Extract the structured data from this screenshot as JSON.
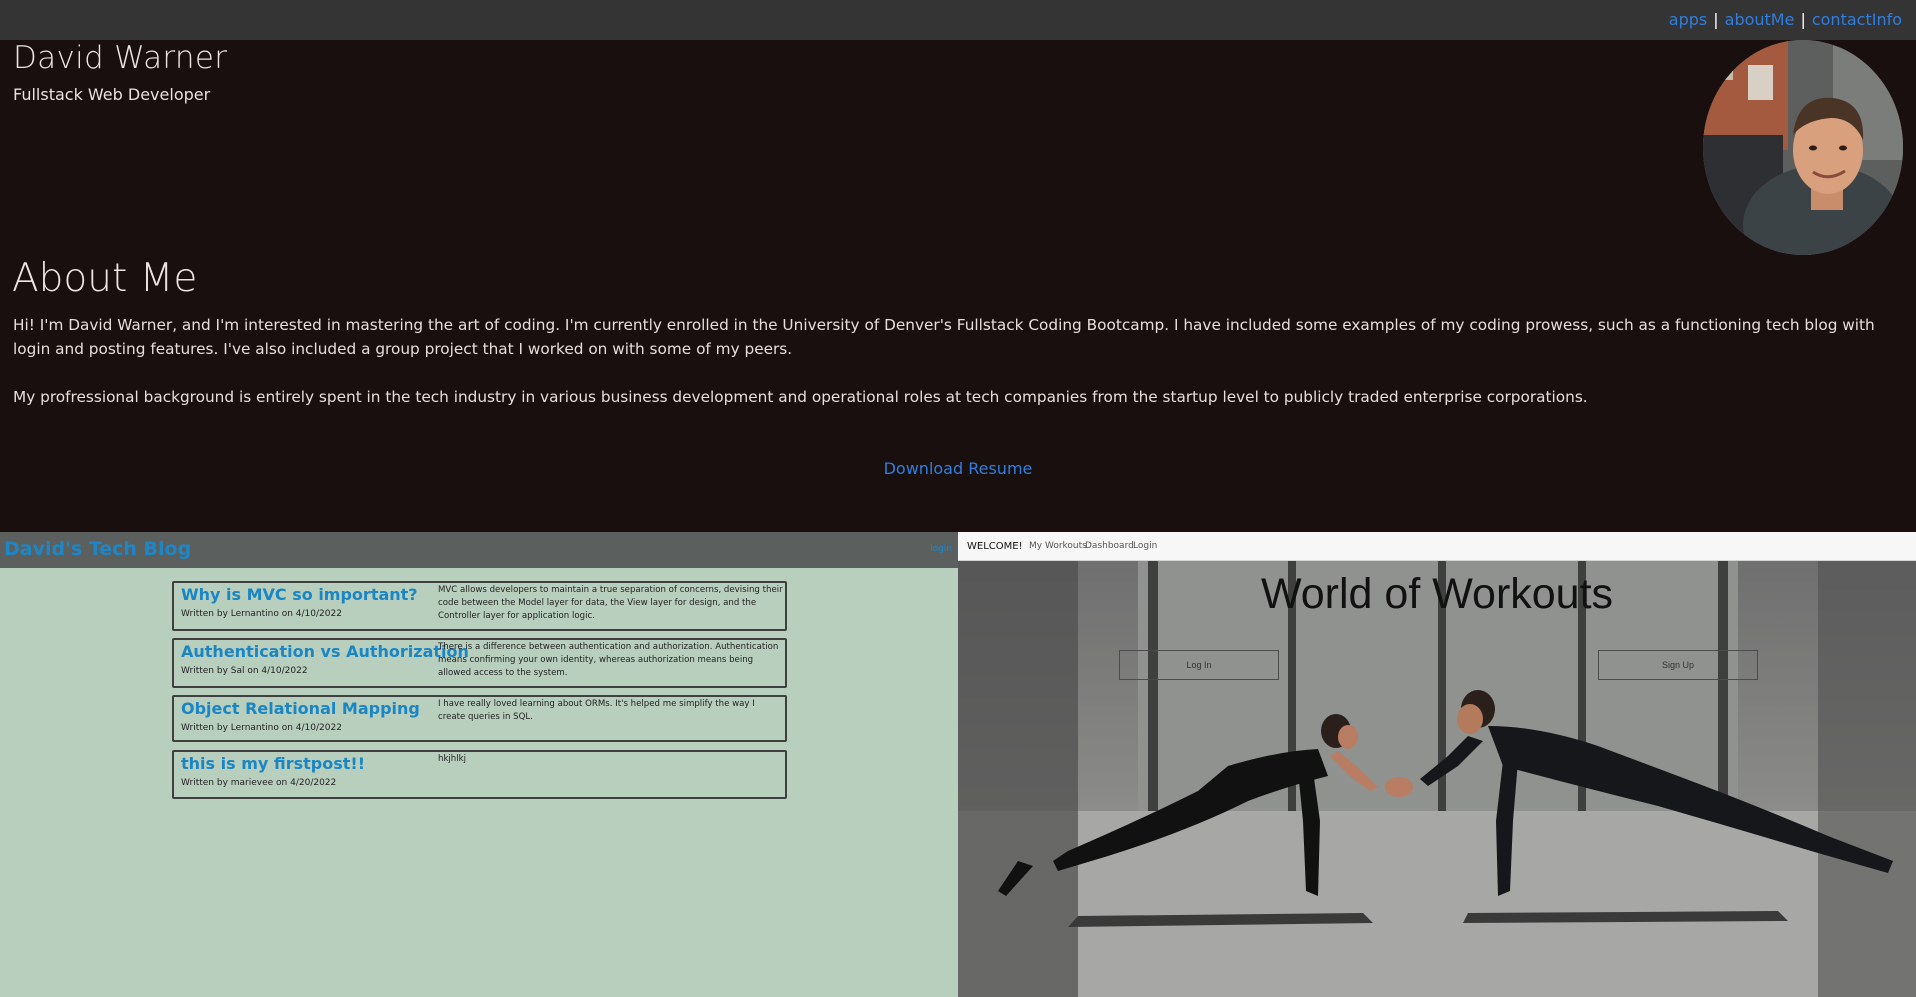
{
  "nav": {
    "links": [
      "apps",
      "aboutMe",
      "contactInfo"
    ],
    "separator": "|"
  },
  "header": {
    "name": "David Warner",
    "title": "Fullstack Web Developer"
  },
  "about": {
    "heading": "About Me",
    "paragraph1": "Hi! I'm David Warner, and I'm interested in mastering the art of coding. I'm currently enrolled in the University of Denver's Fullstack Coding Bootcamp. I have included some examples of my coding prowess, such as a functioning tech blog with login and posting features. I've also included a group project that I worked on with some of my peers.",
    "paragraph2": "My profressional background is entirely spent in the tech industry in various business development and operational roles at tech companies from the startup level to publicly traded enterprise corporations.",
    "resume_link": "Download Resume"
  },
  "tech_blog": {
    "title": "David's Tech Blog",
    "login": "login",
    "posts": [
      {
        "title": "Why is MVC so important?",
        "meta": "Written by Lernantino on 4/10/2022",
        "body": "MVC allows developers to maintain a true separation of concerns, devising their code between the Model layer for data, the View layer for design, and the Controller layer for application logic."
      },
      {
        "title": "Authentication vs Authorization",
        "meta": "Written by Sal on 4/10/2022",
        "body": "There is a difference between authentication and authorization. Authentication means confirming your own identity, whereas authorization means being allowed access to the system."
      },
      {
        "title": "Object Relational Mapping",
        "meta": "Written by Lernantino on 4/10/2022",
        "body": "I have really loved learning about ORMs. It's helped me simplify the way I create queries in SQL."
      },
      {
        "title": "this is my firstpost!!",
        "meta": "Written by marievee on 4/20/2022",
        "body": "hkjhlkj"
      }
    ]
  },
  "workouts": {
    "brand": "WELCOME!",
    "nav_links": [
      "My Workouts",
      "Dashboard",
      "Login"
    ],
    "title": "World of Workouts",
    "login_button": "Log In",
    "signup_button": "Sign Up"
  },
  "colors": {
    "page_bg": "#190f0f",
    "nav_bg": "#343434",
    "link": "#2f7ee0",
    "blog_bg": "#b9cfbe",
    "blog_accent": "#1a86c3"
  }
}
